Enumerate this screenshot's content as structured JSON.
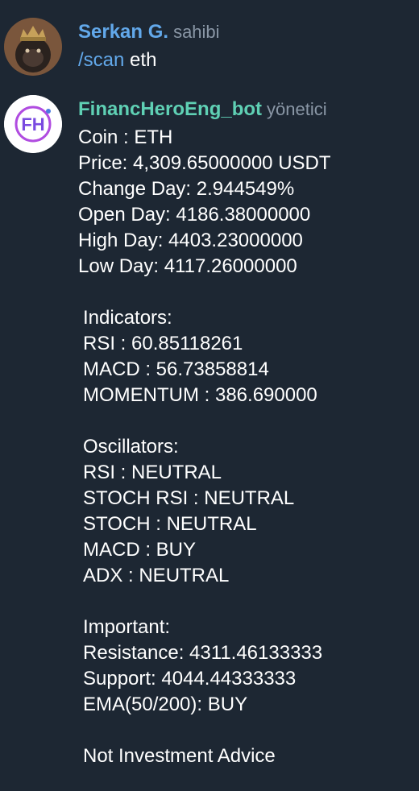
{
  "messages": [
    {
      "sender": "Serkan G.",
      "role": "sahibi",
      "sender_color": "#62a8ea",
      "avatar_icon": "gorilla-king-avatar",
      "command": "/scan",
      "argument": "eth"
    },
    {
      "sender": "FinancHeroEng_bot",
      "role": "yönetici",
      "sender_color": "#5fd0b4",
      "avatar_text": "FH",
      "lines": [
        "Coin : ETH",
        "Price: 4,309.65000000 USDT",
        "Change Day: 2.944549%",
        "Open Day: 4186.38000000",
        "High Day: 4403.23000000",
        "Low Day: 4117.26000000"
      ],
      "indicators": {
        "title": "Indicators:",
        "lines": [
          "RSI : 60.85118261",
          "MACD : 56.73858814",
          "MOMENTUM : 386.690000"
        ]
      },
      "oscillators": {
        "title": "Oscillators:",
        "lines": [
          "RSI : NEUTRAL",
          "STOCH RSI : NEUTRAL",
          "STOCH : NEUTRAL",
          "MACD : BUY",
          "ADX : NEUTRAL"
        ]
      },
      "important": {
        "title": "Important:",
        "lines": [
          "Resistance: 4311.46133333",
          "Support: 4044.44333333",
          "EMA(50/200): BUY"
        ]
      },
      "footer": "Not Investment Advice"
    }
  ]
}
